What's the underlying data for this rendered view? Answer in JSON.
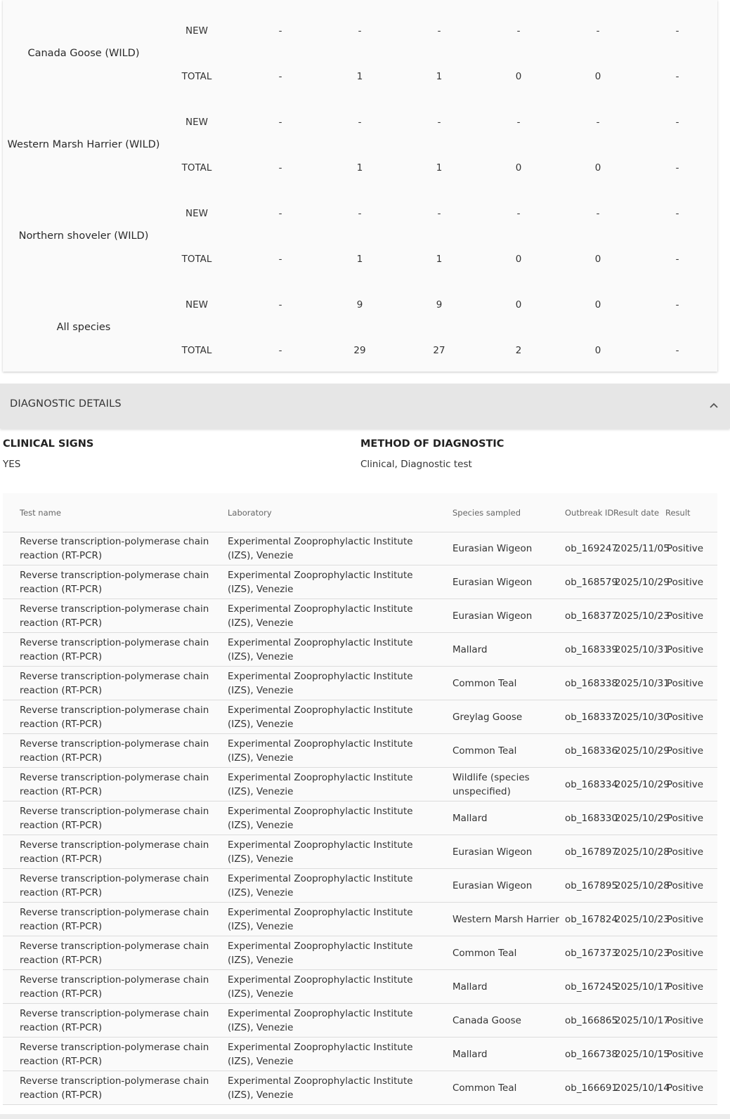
{
  "species_table": {
    "row_labels": {
      "new": "NEW",
      "total": "TOTAL"
    },
    "species": [
      {
        "name": "Canada Goose (WILD)",
        "new": [
          "-",
          "-",
          "-",
          "-",
          "-",
          "-"
        ],
        "total": [
          "-",
          "1",
          "1",
          "0",
          "0",
          "-"
        ]
      },
      {
        "name": "Western Marsh Harrier (WILD)",
        "new": [
          "-",
          "-",
          "-",
          "-",
          "-",
          "-"
        ],
        "total": [
          "-",
          "1",
          "1",
          "0",
          "0",
          "-"
        ]
      },
      {
        "name": "Northern shoveler (WILD)",
        "new": [
          "-",
          "-",
          "-",
          "-",
          "-",
          "-"
        ],
        "total": [
          "-",
          "1",
          "1",
          "0",
          "0",
          "-"
        ]
      },
      {
        "name": "All species",
        "new": [
          "-",
          "9",
          "9",
          "0",
          "0",
          "-"
        ],
        "total": [
          "-",
          "29",
          "27",
          "2",
          "0",
          "-"
        ]
      }
    ]
  },
  "diagnostic": {
    "title": "DIAGNOSTIC DETAILS",
    "collapse_icon": "chevron-up-icon",
    "clinical_signs_label": "CLINICAL SIGNS",
    "clinical_signs_value": "YES",
    "method_label": "METHOD OF DIAGNOSTIC",
    "method_value": "Clinical, Diagnostic test"
  },
  "tests": {
    "headers": {
      "test_name": "Test name",
      "laboratory": "Laboratory",
      "species_sampled": "Species sampled",
      "outbreak_id": "Outbreak ID",
      "result_date": "Result date",
      "result": "Result"
    },
    "rows": [
      {
        "test": "Reverse transcription-polymerase chain reaction (RT-PCR)",
        "lab": "Experimental Zooprophylactic Institute (IZS), Venezie",
        "species": "Eurasian Wigeon",
        "outbreak_id": "ob_169247",
        "date": "2025/11/05",
        "result": "Positive"
      },
      {
        "test": "Reverse transcription-polymerase chain reaction (RT-PCR)",
        "lab": "Experimental Zooprophylactic Institute (IZS), Venezie",
        "species": "Eurasian Wigeon",
        "outbreak_id": "ob_168579",
        "date": "2025/10/29",
        "result": "Positive"
      },
      {
        "test": "Reverse transcription-polymerase chain reaction (RT-PCR)",
        "lab": "Experimental Zooprophylactic Institute (IZS), Venezie",
        "species": "Eurasian Wigeon",
        "outbreak_id": "ob_168377",
        "date": "2025/10/23",
        "result": "Positive"
      },
      {
        "test": "Reverse transcription-polymerase chain reaction (RT-PCR)",
        "lab": "Experimental Zooprophylactic Institute (IZS), Venezie",
        "species": "Mallard",
        "outbreak_id": "ob_168339",
        "date": "2025/10/31",
        "result": "Positive"
      },
      {
        "test": "Reverse transcription-polymerase chain reaction (RT-PCR)",
        "lab": "Experimental Zooprophylactic Institute (IZS), Venezie",
        "species": "Common Teal",
        "outbreak_id": "ob_168338",
        "date": "2025/10/31",
        "result": "Positive"
      },
      {
        "test": "Reverse transcription-polymerase chain reaction (RT-PCR)",
        "lab": "Experimental Zooprophylactic Institute (IZS), Venezie",
        "species": "Greylag Goose",
        "outbreak_id": "ob_168337",
        "date": "2025/10/30",
        "result": "Positive"
      },
      {
        "test": "Reverse transcription-polymerase chain reaction (RT-PCR)",
        "lab": "Experimental Zooprophylactic Institute (IZS), Venezie",
        "species": "Common Teal",
        "outbreak_id": "ob_168336",
        "date": "2025/10/29",
        "result": "Positive"
      },
      {
        "test": "Reverse transcription-polymerase chain reaction (RT-PCR)",
        "lab": "Experimental Zooprophylactic Institute (IZS), Venezie",
        "species": "Wildlife (species unspecified)",
        "outbreak_id": "ob_168334",
        "date": "2025/10/29",
        "result": "Positive"
      },
      {
        "test": "Reverse transcription-polymerase chain reaction (RT-PCR)",
        "lab": "Experimental Zooprophylactic Institute (IZS), Venezie",
        "species": "Mallard",
        "outbreak_id": "ob_168330",
        "date": "2025/10/29",
        "result": "Positive"
      },
      {
        "test": "Reverse transcription-polymerase chain reaction (RT-PCR)",
        "lab": "Experimental Zooprophylactic Institute (IZS), Venezie",
        "species": "Eurasian Wigeon",
        "outbreak_id": "ob_167897",
        "date": "2025/10/28",
        "result": "Positive"
      },
      {
        "test": "Reverse transcription-polymerase chain reaction (RT-PCR)",
        "lab": "Experimental Zooprophylactic Institute (IZS), Venezie",
        "species": "Eurasian Wigeon",
        "outbreak_id": "ob_167895",
        "date": "2025/10/28",
        "result": "Positive"
      },
      {
        "test": "Reverse transcription-polymerase chain reaction (RT-PCR)",
        "lab": "Experimental Zooprophylactic Institute (IZS), Venezie",
        "species": "Western Marsh Harrier",
        "outbreak_id": "ob_167824",
        "date": "2025/10/23",
        "result": "Positive"
      },
      {
        "test": "Reverse transcription-polymerase chain reaction (RT-PCR)",
        "lab": "Experimental Zooprophylactic Institute (IZS), Venezie",
        "species": "Common Teal",
        "outbreak_id": "ob_167373",
        "date": "2025/10/23",
        "result": "Positive"
      },
      {
        "test": "Reverse transcription-polymerase chain reaction (RT-PCR)",
        "lab": "Experimental Zooprophylactic Institute (IZS), Venezie",
        "species": "Mallard",
        "outbreak_id": "ob_167245",
        "date": "2025/10/17",
        "result": "Positive"
      },
      {
        "test": "Reverse transcription-polymerase chain reaction (RT-PCR)",
        "lab": "Experimental Zooprophylactic Institute (IZS), Venezie",
        "species": "Canada Goose",
        "outbreak_id": "ob_166865",
        "date": "2025/10/17",
        "result": "Positive"
      },
      {
        "test": "Reverse transcription-polymerase chain reaction (RT-PCR)",
        "lab": "Experimental Zooprophylactic Institute (IZS), Venezie",
        "species": "Mallard",
        "outbreak_id": "ob_166738",
        "date": "2025/10/15",
        "result": "Positive"
      },
      {
        "test": "Reverse transcription-polymerase chain reaction (RT-PCR)",
        "lab": "Experimental Zooprophylactic Institute (IZS), Venezie",
        "species": "Common Teal",
        "outbreak_id": "ob_166691",
        "date": "2025/10/14",
        "result": "Positive"
      }
    ]
  }
}
